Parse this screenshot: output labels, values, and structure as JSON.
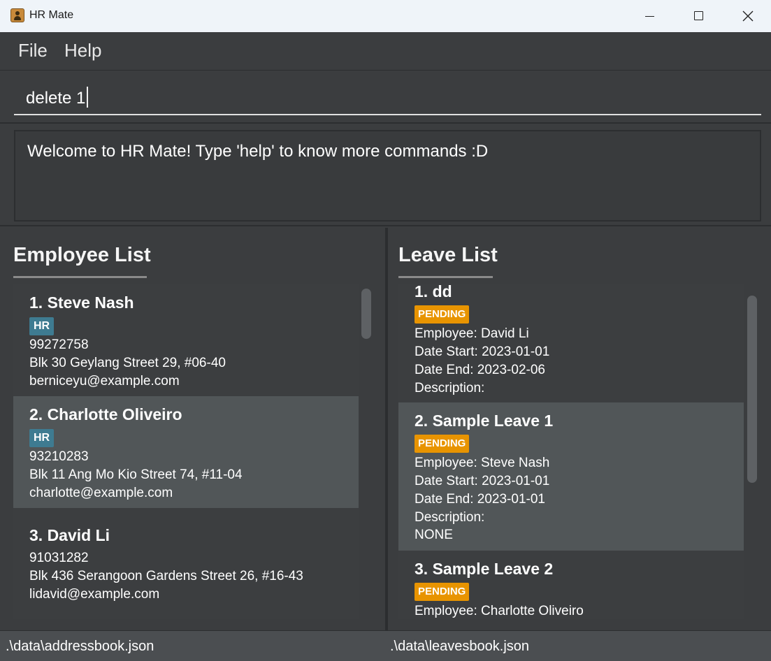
{
  "window": {
    "title": "HR Mate"
  },
  "menu": {
    "file": "File",
    "help": "Help"
  },
  "command": {
    "value": "delete 1"
  },
  "result": {
    "message": "Welcome to HR Mate! Type 'help' to know more commands :D"
  },
  "employee_panel": {
    "title": "Employee List",
    "employees": [
      {
        "index_name": "1.  Steve Nash",
        "tag": "HR",
        "phone": "99272758",
        "address": "Blk 30 Geylang Street 29, #06-40",
        "email": "berniceyu@example.com"
      },
      {
        "index_name": "2.  Charlotte Oliveiro",
        "tag": "HR",
        "phone": "93210283",
        "address": "Blk 11 Ang Mo Kio Street 74, #11-04",
        "email": "charlotte@example.com"
      },
      {
        "index_name": "3.  David Li",
        "phone": "91031282",
        "address": "Blk 436 Serangoon Gardens Street 26, #16-43",
        "email": "lidavid@example.com"
      }
    ]
  },
  "leave_panel": {
    "title": "Leave List",
    "leaves": [
      {
        "index_name": "1.  dd",
        "status": "PENDING",
        "employee": "Employee: David Li",
        "date_start": "Date Start: 2023-01-01",
        "date_end": "Date End: 2023-02-06",
        "description_label": "Description:"
      },
      {
        "index_name": "2.  Sample Leave 1",
        "status": "PENDING",
        "employee": "Employee: Steve Nash",
        "date_start": "Date Start: 2023-01-01",
        "date_end": "Date End: 2023-01-01",
        "description_label": "Description:",
        "description": "NONE"
      },
      {
        "index_name": "3.  Sample Leave 2",
        "status": "PENDING",
        "employee": "Employee: Charlotte Oliveiro"
      }
    ]
  },
  "statusbar": {
    "address_file": ".\\data\\addressbook.json",
    "leave_file": ".\\data\\leavesbook.json"
  },
  "colors": {
    "tag_hr": "#3e7b91",
    "status_pending": "#e89400",
    "background": "#3b3d3f",
    "selected_row": "#515658"
  },
  "icons": {
    "app": "person-icon",
    "minimize": "minimize-icon",
    "maximize": "maximize-icon",
    "close": "close-icon"
  }
}
